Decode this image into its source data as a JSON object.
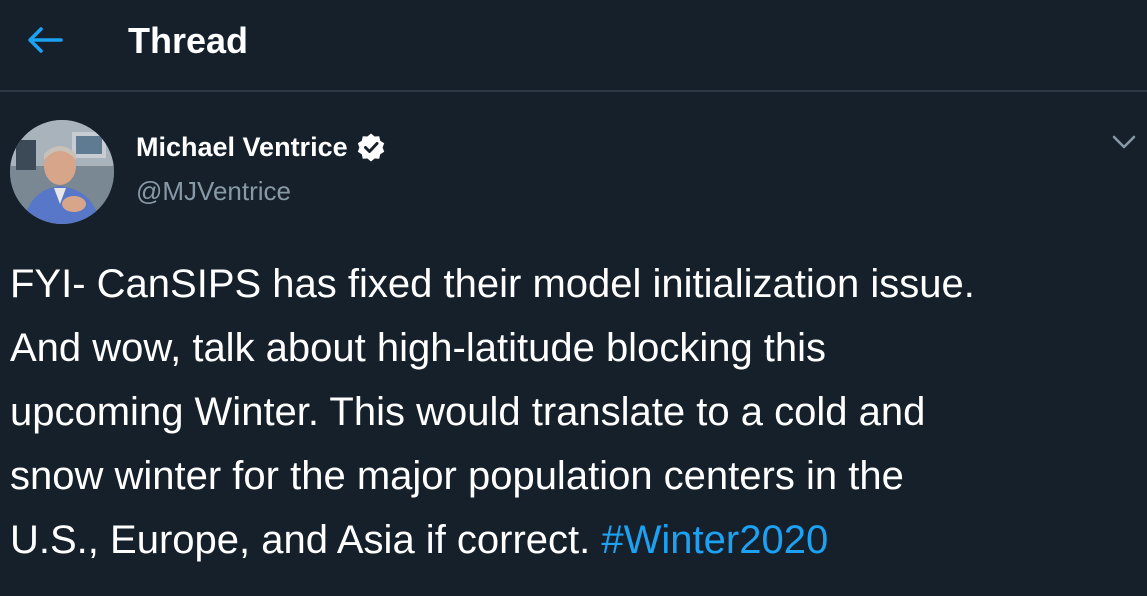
{
  "header": {
    "title": "Thread",
    "back_icon": "arrow-left-icon",
    "accent": "#1da1f2"
  },
  "tweet": {
    "author_name": "Michael Ventrice",
    "handle": "@MJVentrice",
    "verified": true,
    "avatar_icon": "profile-photo",
    "menu_icon": "chevron-down-icon",
    "lines": [
      "FYI- CanSIPS has fixed their model initialization issue.",
      "And wow, talk about high-latitude blocking this",
      "upcoming Winter.  This would translate to a cold and",
      "snow winter for the major population centers in the",
      "U.S., Europe, and Asia if correct. "
    ],
    "hashtag": "#Winter2020"
  },
  "colors": {
    "background": "#15202b",
    "text": "#ffffff",
    "secondary": "#8899a6",
    "link": "#1da1f2",
    "divider": "#2b3743"
  }
}
